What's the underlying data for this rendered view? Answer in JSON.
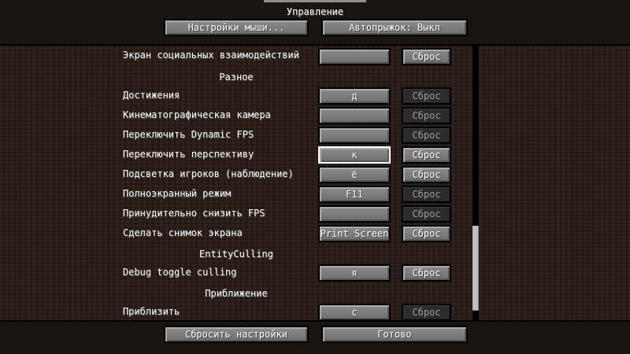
{
  "header": {
    "title": "Управление",
    "mouse_settings": "Настройки мыши...",
    "autojump": "Автопрыжок: Выкл"
  },
  "rows": [
    {
      "label": "Экран социальных взаимодействий",
      "key": "",
      "reset": "Сброс",
      "reset_enabled": true
    },
    {
      "label": "Достижения",
      "key": "д",
      "reset": "Сброс",
      "reset_enabled": false
    },
    {
      "label": "Кинематографическая камера",
      "key": "",
      "reset": "Сброс",
      "reset_enabled": false
    },
    {
      "label": "Переключить Dynamic FPS",
      "key": "",
      "reset": "Сброс",
      "reset_enabled": false
    },
    {
      "label": "Переключить перспективу",
      "key": "к",
      "reset": "Сброс",
      "reset_enabled": true,
      "focused": true
    },
    {
      "label": "Подсветка игроков (наблюдение)",
      "key": "ё",
      "reset": "Сброс",
      "reset_enabled": true
    },
    {
      "label": "Полноэкранный режим",
      "key": "F11",
      "reset": "Сброс",
      "reset_enabled": false
    },
    {
      "label": "Принудительно снизить FPS",
      "key": "",
      "reset": "Сброс",
      "reset_enabled": false
    },
    {
      "label": "Сделать снимок экрана",
      "key": "Print Screen",
      "reset": "Сброс",
      "reset_enabled": true
    },
    {
      "label": "Debug toggle culling",
      "key": "я",
      "reset": "Сброс",
      "reset_enabled": true
    },
    {
      "label": "Приблизить",
      "key": "с",
      "reset": "Сброс",
      "reset_enabled": false
    }
  ],
  "sections": [
    "Разное",
    "EntityCulling",
    "Приближение"
  ],
  "footer": {
    "reset_all": "Сбросить настройки",
    "done": "Готово"
  },
  "scroll": {
    "position": 0.95
  }
}
